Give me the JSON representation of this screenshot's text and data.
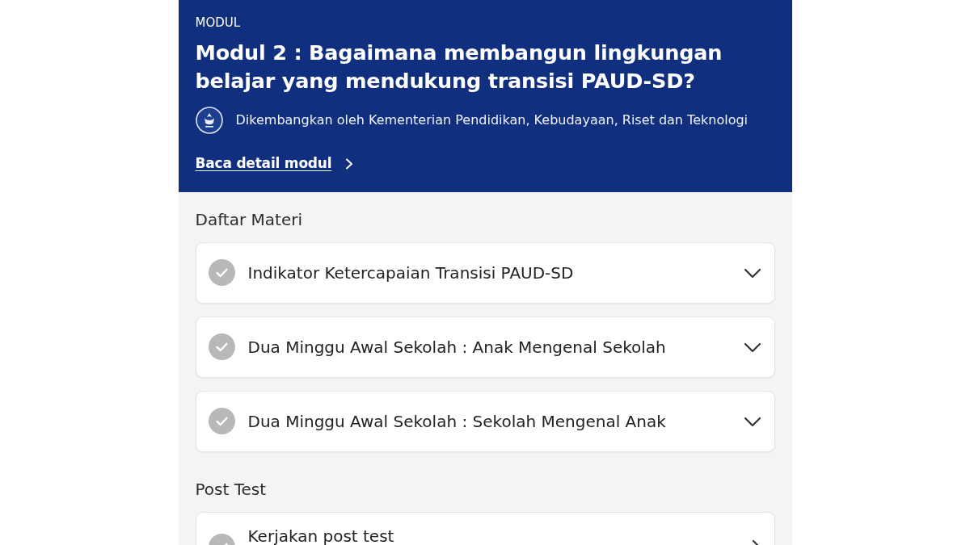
{
  "header": {
    "eyebrow": "MODUL",
    "title": "Modul 2 : Bagaimana membangun lingkungan belajar yang mendukung transisi PAUD-SD?",
    "developer": "Dikembangkan oleh Kementerian Pendidikan, Kebudayaan, Riset dan Teknologi",
    "detail_link": "Baca detail modul"
  },
  "sections": [
    {
      "title": "Daftar Materi",
      "items": [
        {
          "kind": "accordion",
          "label": "Indikator Ketercapaian Transisi PAUD-SD",
          "completed": false,
          "expanded": false
        },
        {
          "kind": "accordion",
          "label": "Dua Minggu Awal Sekolah : Anak Mengenal Sekolah",
          "completed": false,
          "expanded": false
        },
        {
          "kind": "accordion",
          "label": "Dua Minggu Awal Sekolah : Sekolah Mengenal Anak",
          "completed": false,
          "expanded": false
        }
      ]
    },
    {
      "title": "Post Test",
      "items": [
        {
          "kind": "link",
          "label": "Kerjakan post test",
          "completed": false
        }
      ]
    }
  ]
}
